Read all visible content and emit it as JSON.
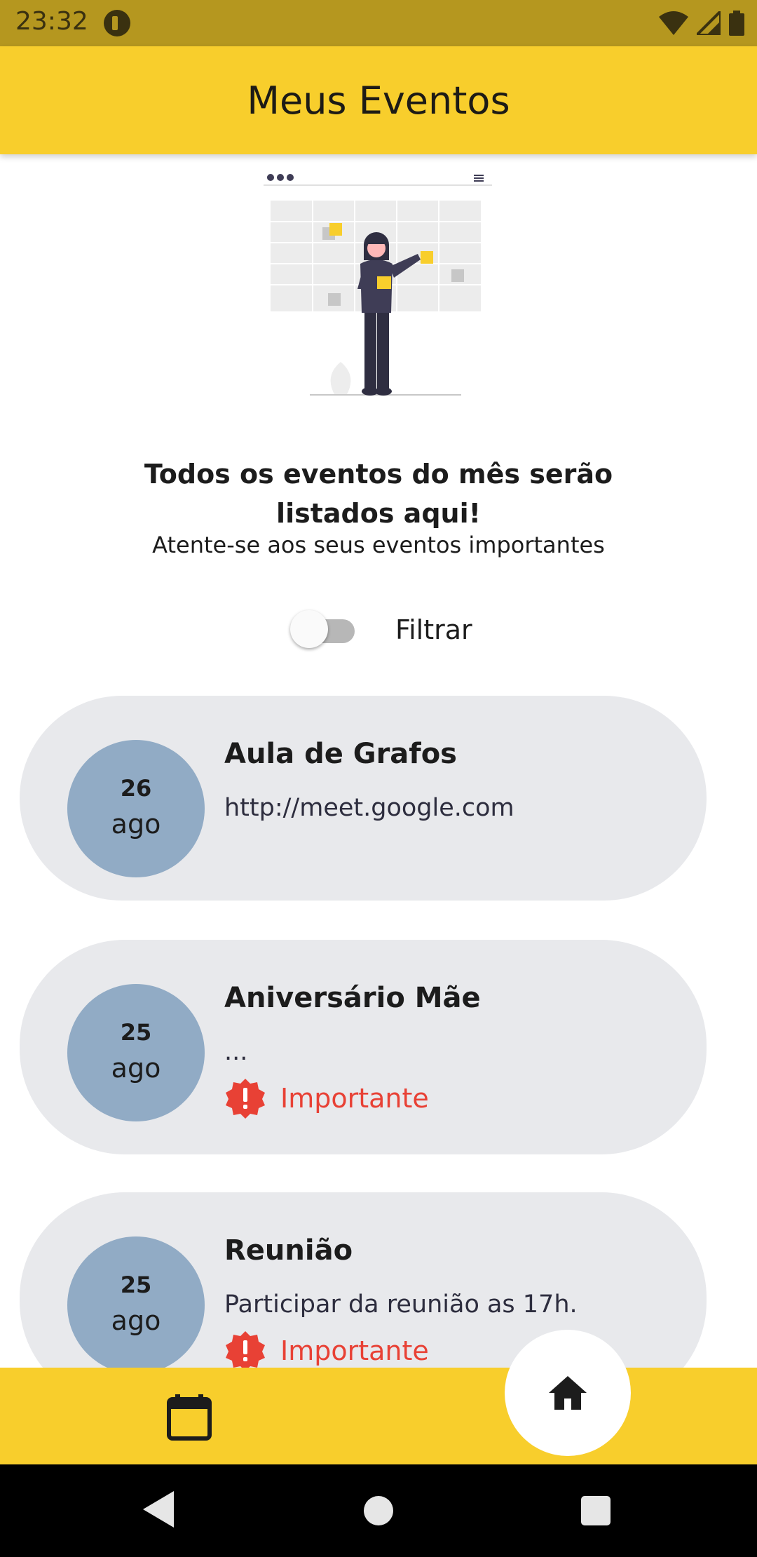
{
  "status_bar": {
    "time": "23:32"
  },
  "app_bar": {
    "title": "Meus Eventos"
  },
  "intro": {
    "headline_line1": "Todos os eventos do mês serão",
    "headline_line2": "listados aqui!",
    "subheadline": "Atente-se aos seus eventos importantes"
  },
  "filter": {
    "label": "Filtrar",
    "enabled": false
  },
  "events": [
    {
      "day": "26",
      "month": "ago",
      "title": "Aula de Grafos",
      "description": "http://meet.google.com",
      "important": false
    },
    {
      "day": "25",
      "month": "ago",
      "title": "Aniversário Mãe",
      "description": "...",
      "important": true,
      "important_label": "Importante"
    },
    {
      "day": "25",
      "month": "ago",
      "title": "Reunião",
      "description": "Participar da reunião as 17h.",
      "important": true,
      "important_label": "Importante"
    }
  ],
  "bottom_nav": {
    "items": [
      {
        "icon": "calendar-icon"
      },
      {
        "icon": "home-icon",
        "active": true
      }
    ]
  },
  "colors": {
    "status_bar": "#b5971f",
    "app_bar": "#f8ce2c",
    "card_background": "#e8e9ec",
    "date_circle": "#91abc5",
    "important": "#e84135"
  }
}
